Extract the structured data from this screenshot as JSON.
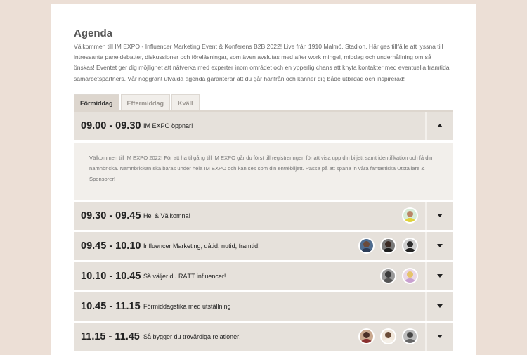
{
  "agenda": {
    "title": "Agenda",
    "intro": "Välkommen till IM EXPO - Influencer Marketing Event & Konferens B2B 2022! Live från 1910 Malmö, Stadion. Här ges tillfälle att lyssna till intressanta paneldebatter, diskussioner och föreläsningar, som även avslutas med after work mingel, middag och underhållning om så önskas! Eventet ger dig möjlighet att nätverka med experter inom området och en ypperlig chans att knyta kontakter med eventuella framtida samarbetspartners. Vår noggrant utvalda agenda garanterar att du går härifrån och känner dig både utbildad och inspirerad!",
    "tabs": [
      "Förmiddag",
      "Eftermiddag",
      "Kväll"
    ],
    "sessions": [
      {
        "time": "09.00 - 09.30",
        "title": "IM EXPO öppnar!",
        "description": "Välkommen till IM EXPO 2022! För att ha tillgång till IM EXPO går du först till registreringen för att visa upp din biljett samt identifikation och få din namnbricka. Namnbrickan ska bäras under hela IM EXPO och kan ses som din entrébiljett. Passa på att spana in våra fantastiska Utställare & Sponsorer!"
      },
      {
        "time": "09.30 - 09.45",
        "title": "Hej & Välkomna!"
      },
      {
        "time": "09.45 - 10.10",
        "title": "Influencer Marketing, dåtid, nutid, framtid!"
      },
      {
        "time": "10.10 - 10.45",
        "title": "Så väljer du RÄTT influencer!"
      },
      {
        "time": "10.45 - 11.15",
        "title": "Förmiddagsfika med utställning"
      },
      {
        "time": "11.15 - 11.45",
        "title": "Så bygger du trovärdiga relationer!"
      }
    ]
  },
  "icons": {
    "collapse": "caret-up-icon",
    "expand": "caret-down-icon",
    "speaker": "speaker-avatar"
  },
  "colors": {
    "page_bg": "#ecdfd6",
    "row_bg": "#e6e1db",
    "active_tab": "#ddd6ce"
  }
}
